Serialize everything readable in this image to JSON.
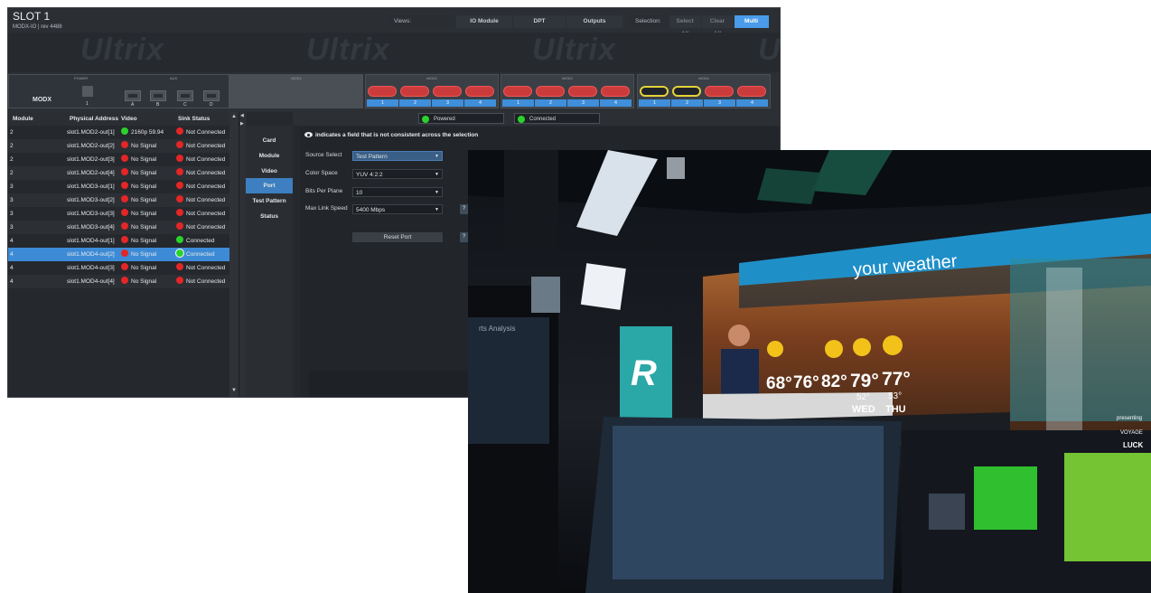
{
  "header": {
    "title": "SLOT 1",
    "subtitle": "MODX-IO | rev 4488"
  },
  "views": {
    "label": "Views:",
    "io_module": "IO Module",
    "dpt": "DPT",
    "outputs": "Outputs",
    "selection_label": "Selection:",
    "select_all": "Select All",
    "clear_all": "Clear All",
    "multi": "Multi"
  },
  "banner": {
    "watermark": "Ultrix"
  },
  "module_row": {
    "label": "MODX",
    "power_label": "POWER",
    "aux_label": "AUX",
    "slot_labels": [
      "MOD1",
      "MOD2",
      "MOD3",
      "MOD4"
    ],
    "power_number": "1",
    "aux_buttons": [
      "A",
      "B",
      "C",
      "D"
    ],
    "port_numbers": [
      "1",
      "2",
      "3",
      "4"
    ]
  },
  "table": {
    "headers": {
      "module": "Module",
      "address": "Physical Address",
      "video": "Video",
      "sink": "Sink Status"
    },
    "rows": [
      {
        "module": "2",
        "address": "slot1.MOD2-out[1]",
        "video": "2160p 59.94",
        "video_ok": true,
        "sink": "Not Connected",
        "sink_ok": false
      },
      {
        "module": "2",
        "address": "slot1.MOD2-out[2]",
        "video": "No Signal",
        "video_ok": false,
        "sink": "Not Connected",
        "sink_ok": false
      },
      {
        "module": "2",
        "address": "slot1.MOD2-out[3]",
        "video": "No Signal",
        "video_ok": false,
        "sink": "Not Connected",
        "sink_ok": false
      },
      {
        "module": "2",
        "address": "slot1.MOD2-out[4]",
        "video": "No Signal",
        "video_ok": false,
        "sink": "Not Connected",
        "sink_ok": false
      },
      {
        "module": "3",
        "address": "slot1.MOD3-out[1]",
        "video": "No Signal",
        "video_ok": false,
        "sink": "Not Connected",
        "sink_ok": false
      },
      {
        "module": "3",
        "address": "slot1.MOD3-out[2]",
        "video": "No Signal",
        "video_ok": false,
        "sink": "Not Connected",
        "sink_ok": false
      },
      {
        "module": "3",
        "address": "slot1.MOD3-out[3]",
        "video": "No Signal",
        "video_ok": false,
        "sink": "Not Connected",
        "sink_ok": false
      },
      {
        "module": "3",
        "address": "slot1.MOD3-out[4]",
        "video": "No Signal",
        "video_ok": false,
        "sink": "Not Connected",
        "sink_ok": false
      },
      {
        "module": "4",
        "address": "slot1.MOD4-out[1]",
        "video": "No Signal",
        "video_ok": false,
        "sink": "Connected",
        "sink_ok": true
      },
      {
        "module": "4",
        "address": "slot1.MOD4-out[2]",
        "video": "No Signal",
        "video_ok": false,
        "sink": "Connected",
        "sink_ok": true,
        "selected": true
      },
      {
        "module": "4",
        "address": "slot1.MOD4-out[3]",
        "video": "No Signal",
        "video_ok": false,
        "sink": "Not Connected",
        "sink_ok": false
      },
      {
        "module": "4",
        "address": "slot1.MOD4-out[4]",
        "video": "No Signal",
        "video_ok": false,
        "sink": "Not Connected",
        "sink_ok": false
      }
    ]
  },
  "tabs": [
    "Card",
    "Module",
    "Video",
    "Port",
    "Test Pattern",
    "Status"
  ],
  "active_tab": "Port",
  "status": {
    "powered": "Powered",
    "connected": "Connected"
  },
  "form": {
    "note": "indicates a field that is not consistent across the selection",
    "fields": [
      {
        "label": "Source Select",
        "value": "Test Pattern"
      },
      {
        "label": "Color Space",
        "value": "YUV 4:2:2"
      },
      {
        "label": "Bits Per Plane",
        "value": "10"
      },
      {
        "label": "Max Link Speed",
        "value": "5400 Mbps"
      }
    ],
    "help": "?",
    "reset": "Reset Port"
  },
  "photo": {
    "headline": "your weather",
    "logo": "R",
    "screen_text": "rts Analysis",
    "temps": [
      "68°",
      "76°",
      "82°",
      "79°",
      "77°"
    ],
    "lows": [
      "52°",
      "53°"
    ],
    "days": [
      "WED",
      "THU"
    ],
    "sponsor": [
      "presenting",
      "VOYAGE",
      "LUCK"
    ]
  },
  "colors": {
    "accent": "#4a9bea",
    "bad": "#e32626",
    "good": "#2bd22b",
    "selected_row": "#3d8bd6",
    "warning_pill": "#e4d23a"
  }
}
